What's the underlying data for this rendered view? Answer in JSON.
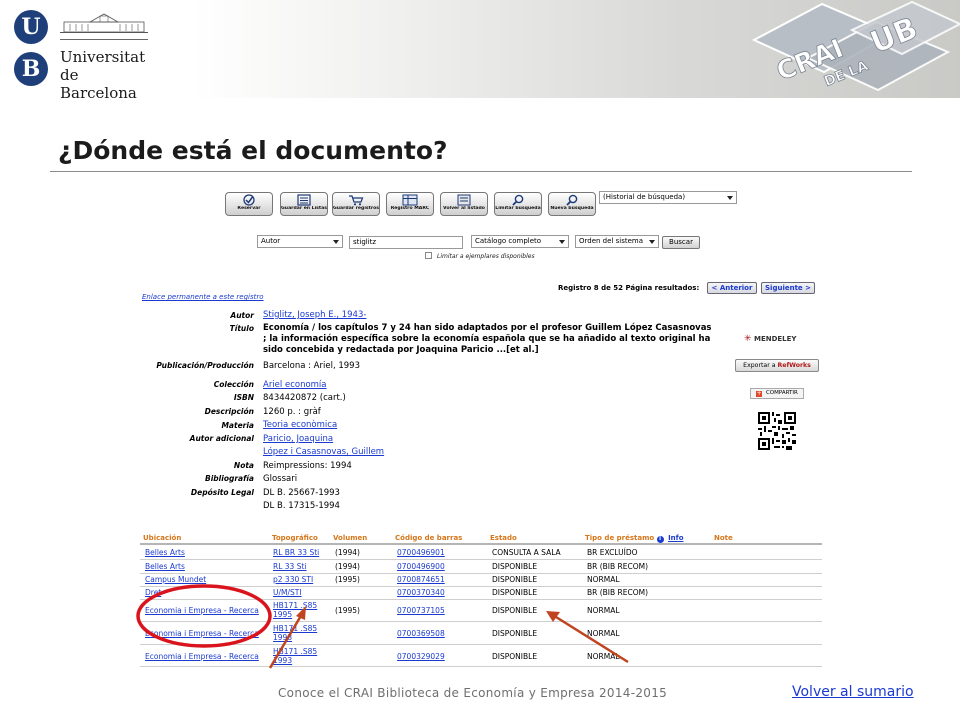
{
  "header": {
    "university_logo_letters": [
      "U",
      "B"
    ],
    "university_name_line1": "Universitat",
    "university_name_line2": "de Barcelona",
    "crai_logo": "CRAI DE LA UB"
  },
  "page_title": "¿Dónde está el documento?",
  "toolbar": {
    "buttons": [
      {
        "label": "Reservar",
        "icon": "check-icon"
      },
      {
        "label": "Guardar en Listas",
        "icon": "list-icon"
      },
      {
        "label": "Guardar registros",
        "icon": "cart-icon"
      },
      {
        "label": "Registro MARC",
        "icon": "marc-icon"
      },
      {
        "label": "Volver al listado",
        "icon": "list-back-icon"
      },
      {
        "label": "Limitar búsqueda",
        "icon": "magnifier-icon"
      },
      {
        "label": "Nueva búsqueda",
        "icon": "magnifier-icon"
      }
    ],
    "history_select": "(Historial de búsqueda)"
  },
  "search": {
    "field_select": "Autor",
    "query_value": "stiglitz",
    "catalog_select": "Catálogo completo",
    "sort_select": "Orden del sistema",
    "search_button": "Buscar",
    "limit_checkbox_label": "Limitar a ejemplares disponibles"
  },
  "record_nav": {
    "permalink": "Enlace permanente a este registro",
    "record_info": "Registro 8 de 52 Página resultados:",
    "prev": "< Anterior",
    "next": "Siguiente >"
  },
  "record": {
    "autor_label": "Autor",
    "autor": "Stiglitz, Joseph E., 1943-",
    "titulo_label": "Título",
    "titulo": "Economía / los capítulos 7 y 24 han sido adaptados por el profesor Guillem López Casasnovas ; la información específica sobre la economía española que se ha añadido al texto original ha sido concebida y redactada por Joaquina Paricio ...[et al.]",
    "publicacion_label": "Publicación/Producción",
    "publicacion": "Barcelona : Ariel, 1993",
    "coleccion_label": "Colección",
    "coleccion": "Ariel economía",
    "isbn_label": "ISBN",
    "isbn": "8434420872 (cart.)",
    "descripcion_label": "Descripción",
    "descripcion": "1260 p. : gràf",
    "materia_label": "Materia",
    "materia": "Teoria econòmica",
    "autor_adicional_label": "Autor adicional",
    "autor_adicional_1": "Paricio, Joaquina",
    "autor_adicional_2": "López i Casasnovas, Guillem",
    "nota_label": "Nota",
    "nota": "Reimpressions: 1994",
    "bibliografia_label": "Bibliografía",
    "bibliografia": "Glossari",
    "deposito_label": "Depósito Legal",
    "deposito_1": "DL B. 25667-1993",
    "deposito_2": "DL B. 17315-1994"
  },
  "side_tools": {
    "mendeley": "MENDELEY",
    "refworks_prefix": "Exportar a",
    "refworks_brand": "RefWorks",
    "share": "COMPARTIR"
  },
  "holdings": {
    "headers": {
      "ubicacion": "Ubicación",
      "topografico": "Topográfico",
      "volumen": "Volumen",
      "codigo": "Código de barras",
      "estado": "Estado",
      "tipo": "Tipo de préstamo",
      "info": "Info",
      "note": "Note"
    },
    "rows": [
      {
        "ubicacion": "Belles Arts",
        "topografico": "RL BR 33 Sti",
        "volumen": "(1994)",
        "codigo": "0700496901",
        "estado": "CONSULTA A SALA",
        "tipo": "BR EXCLUÍDO"
      },
      {
        "ubicacion": "Belles Arts",
        "topografico": "RL 33 Sti",
        "volumen": "(1994)",
        "codigo": "0700496900",
        "estado": "DISPONIBLE",
        "tipo": "BR (BIB RECOM)"
      },
      {
        "ubicacion": "Campus Mundet",
        "topografico": "p2 330 STI",
        "volumen": "(1995)",
        "codigo": "0700874651",
        "estado": "DISPONIBLE",
        "tipo": "NORMAL"
      },
      {
        "ubicacion": "Dret",
        "topografico": "U/M/STI",
        "volumen": "",
        "codigo": "0700370340",
        "estado": "DISPONIBLE",
        "tipo": "BR (BIB RECOM)"
      },
      {
        "ubicacion": "Economia i Empresa - Recerca",
        "topografico": "HB171 .S85 1995",
        "volumen": "(1995)",
        "codigo": "0700737105",
        "estado": "DISPONIBLE",
        "tipo": "NORMAL"
      },
      {
        "ubicacion": "Economia i Empresa - Recerca",
        "topografico": "HB171 .S85 1993",
        "volumen": "",
        "codigo": "0700369508",
        "estado": "DISPONIBLE",
        "tipo": "NORMAL"
      },
      {
        "ubicacion": "Economia i Empresa - Recerca",
        "topografico": "HB171 .S85 1993",
        "volumen": "",
        "codigo": "0700329029",
        "estado": "DISPONIBLE",
        "tipo": "NORMAL"
      }
    ]
  },
  "colors": {
    "link": "#1a3ad0",
    "header_orange": "#d6761a",
    "annotation_red": "#d9141c",
    "arrow_red": "#c0441f",
    "ub_blue": "#1f3f7a"
  },
  "footer": {
    "caption": "Conoce el CRAI Biblioteca de Economía y Empresa 2014-2015",
    "summary_link": "Volver al sumario"
  }
}
